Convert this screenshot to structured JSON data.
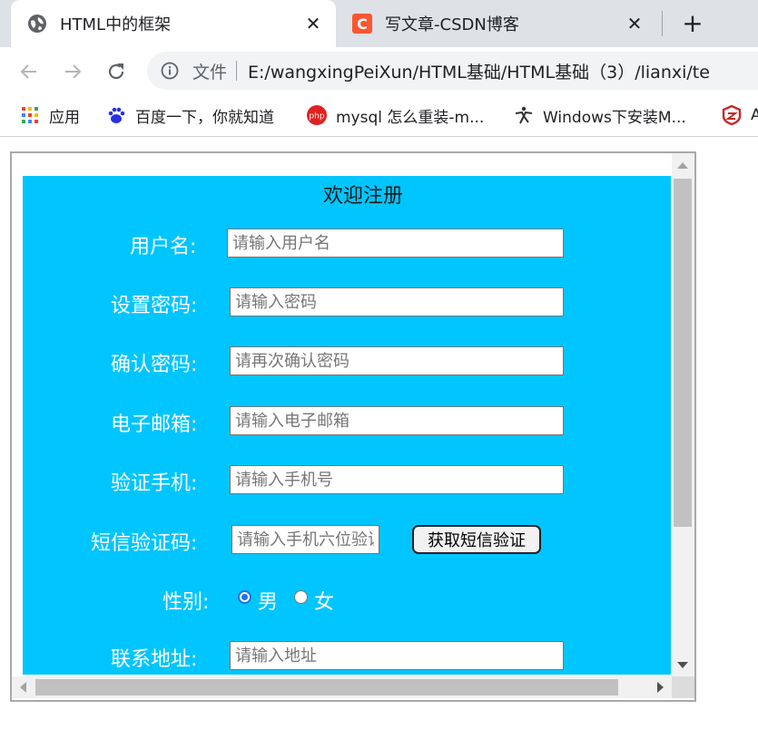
{
  "browser": {
    "tabs": [
      {
        "title": "HTML中的框架",
        "icon": "globe-icon"
      },
      {
        "title": "写文章-CSDN博客",
        "icon": "csdn-icon"
      }
    ],
    "address": {
      "scheme_label": "文件",
      "url": "E:/wangxingPeiXun/HTML基础/HTML基础（3）/lianxi/te"
    },
    "bookmarks": [
      {
        "label": "应用",
        "icon": "apps-grid-icon"
      },
      {
        "label": "百度一下，你就知道",
        "icon": "baidu-paw-icon"
      },
      {
        "label": "mysql 怎么重装-m...",
        "icon": "php-icon"
      },
      {
        "label": "Windows下安装M...",
        "icon": "yoga-icon"
      },
      {
        "label": "A",
        "icon": "shield-logo-icon"
      }
    ]
  },
  "form": {
    "title": "欢迎注册",
    "fields": {
      "username": {
        "label": "用户名:",
        "placeholder": "请输入用户名"
      },
      "password": {
        "label": "设置密码:",
        "placeholder": "请输入密码"
      },
      "confirm": {
        "label": "确认密码:",
        "placeholder": "请再次确认密码"
      },
      "email": {
        "label": "电子邮箱:",
        "placeholder": "请输入电子邮箱"
      },
      "phone": {
        "label": "验证手机:",
        "placeholder": "请输入手机号"
      },
      "sms": {
        "label": "短信验证码:",
        "placeholder": "请输入手机六位验证码",
        "button": "获取短信验证"
      },
      "address": {
        "label": "联系地址:",
        "placeholder": "请输入地址"
      }
    },
    "gender": {
      "label": "性别:",
      "options": [
        "男",
        "女"
      ],
      "selected": "男"
    }
  },
  "colors": {
    "form_bg": "#00c5ff",
    "tab_strip": "#dee1e6",
    "radio_accent": "#1a73e8"
  }
}
